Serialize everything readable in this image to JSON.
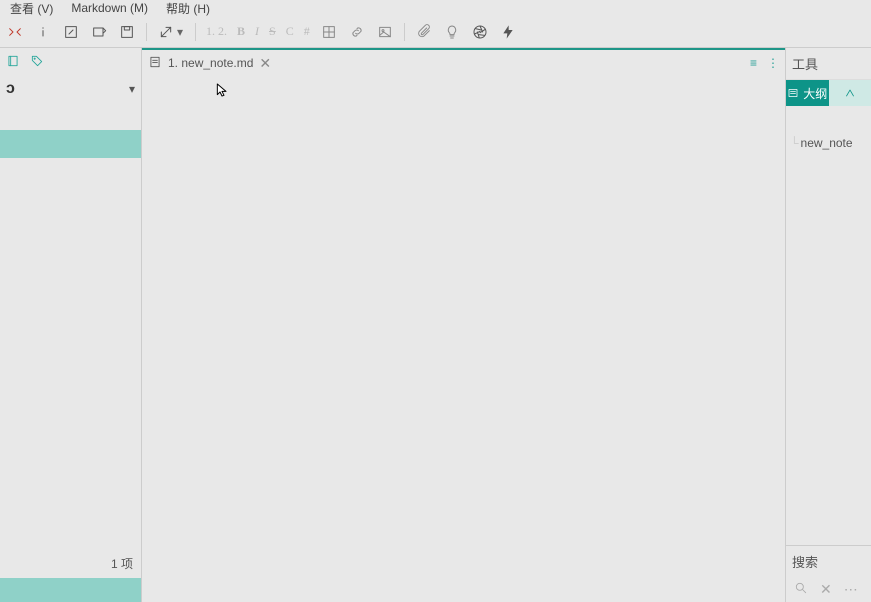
{
  "menu": {
    "view": "查看 (V)",
    "markdown": "Markdown (M)",
    "help": "帮助 (H)"
  },
  "toolbar": {
    "ordered_list": "1. 2.",
    "bold": "B",
    "italic": "I",
    "strike": "S",
    "code_inline": "C",
    "tag": "#"
  },
  "notebook": {
    "title_fragment": "ɔ",
    "item_count": "1 项"
  },
  "tab": {
    "label": "1. new_note.md"
  },
  "right": {
    "tools": "工具",
    "outline": "大纲",
    "outline_entry": "new_note",
    "search": "搜索"
  }
}
